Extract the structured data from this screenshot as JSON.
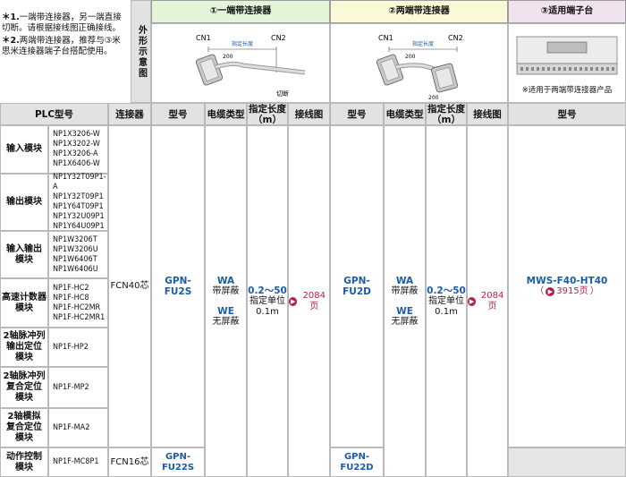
{
  "notes": [
    {
      "mark": "＊1.",
      "text": "一端带连接器，另一端直接切断。请根据接线图正确接线。"
    },
    {
      "mark": "＊2.",
      "text": "两端带连接器，推荐与③米思米连接器端子台搭配使用。"
    }
  ],
  "side_label": "外形示意图",
  "sections": {
    "one_end": "①一端带连接器",
    "two_end": "②两端带连接器",
    "terminal": "③适用端子台"
  },
  "diagram1": {
    "cn1": "CN1",
    "cn2": "CN2",
    "length": "指定长度",
    "dim": "200",
    "cut": "切断"
  },
  "diagram2": {
    "cn1": "CN1",
    "cn2": "CN2",
    "length": "指定长度",
    "dim1": "200",
    "dim2": "200"
  },
  "terminal_note": "※适用于两端带连接器产品",
  "headers": {
    "plc": "PLC型号",
    "connector": "连接器",
    "model1": "型号",
    "cable1": "电缆类型",
    "length1_a": "指定长度",
    "length1_b": "（m）",
    "wiring1": "接线图",
    "model2": "型号",
    "cable2": "电缆类型",
    "length2_a": "指定长度",
    "length2_b": "（m）",
    "wiring2": "接线图",
    "model3": "型号"
  },
  "rows": [
    {
      "category": [
        "输入模块"
      ],
      "models": [
        "NP1X3206-W",
        "NP1X3202-W",
        "NP1X3206-A",
        "NP1X6406-W"
      ]
    },
    {
      "category": [
        "输出模块"
      ],
      "models": [
        "NP1Y32T09P1-A",
        "NP1Y32T09P1",
        "NP1Y64T09P1",
        "NP1Y32U09P1",
        "NP1Y64U09P1"
      ]
    },
    {
      "category": [
        "输入输出",
        "模块"
      ],
      "models": [
        "NP1W3206T",
        "NP1W3206U",
        "NP1W6406T",
        "NP1W6406U"
      ]
    },
    {
      "category": [
        "高速计数器",
        "模块"
      ],
      "models": [
        "NP1F-HC2",
        "NP1F-HC8",
        "NP1F-HC2MR",
        "NP1F-HC2MR1"
      ]
    },
    {
      "category": [
        "2轴脉冲列",
        "输出定位",
        "模块"
      ],
      "models": [
        "NP1F-HP2"
      ]
    },
    {
      "category": [
        "2轴脉冲列",
        "复合定位",
        "模块"
      ],
      "models": [
        "NP1F-MP2"
      ]
    },
    {
      "category": [
        "2轴模拟",
        "复合定位",
        "模块"
      ],
      "models": [
        "NP1F-MA2"
      ]
    },
    {
      "category": [
        "动作控制",
        "模块"
      ],
      "models": [
        "NP1F-MC8P1"
      ]
    }
  ],
  "connector": {
    "main": "FCN40芯",
    "last": "FCN16芯"
  },
  "one_end": {
    "model_main": "GPN-FU2S",
    "model_last": "GPN-FU22S",
    "cable_wa": "WA",
    "cable_wa_desc": "带屏蔽",
    "cable_we": "WE",
    "cable_we_desc": "无屏蔽",
    "length_range": "0.2～50",
    "length_unit": "指定单位",
    "length_step": "0.1m",
    "wiring_page": "2084页"
  },
  "two_end": {
    "model_main": "GPN-FU2D",
    "model_last": "GPN-FU22D",
    "cable_wa": "WA",
    "cable_wa_desc": "带屏蔽",
    "cable_we": "WE",
    "cable_we_desc": "无屏蔽",
    "length_range": "0.2～50",
    "length_unit": "指定单位",
    "length_step": "0.1m",
    "wiring_page": "2084页"
  },
  "terminal": {
    "model": "MWS-F40-HT40",
    "page": "3915页"
  },
  "colors": {
    "blue": "#1b5ca8",
    "red": "#b0234a",
    "green": "#e4f4d9",
    "yellow": "#fafad6",
    "pink": "#f1e3ee"
  }
}
